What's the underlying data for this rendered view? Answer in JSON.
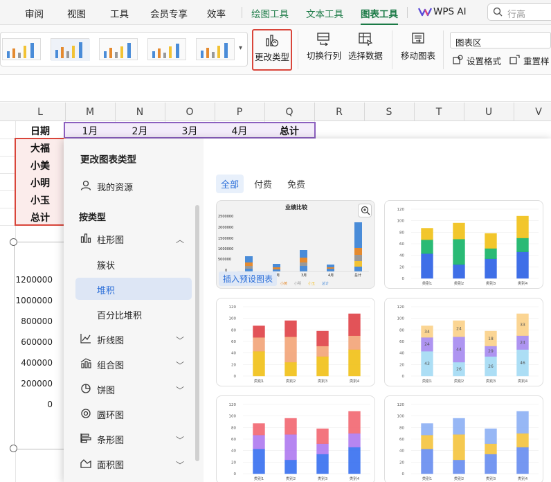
{
  "tabs": [
    {
      "label": "审阅"
    },
    {
      "label": "视图"
    },
    {
      "label": "工具"
    },
    {
      "label": "会员专享"
    },
    {
      "label": "效率"
    },
    {
      "label": "绘图工具"
    },
    {
      "label": "文本工具"
    },
    {
      "label": "图表工具"
    },
    {
      "label": "WPS AI"
    }
  ],
  "search": {
    "placeholder": "行高"
  },
  "ribbon": {
    "change_type": "更改类型",
    "switch_rowcol": "切换行列",
    "select_data": "选择数据",
    "move_chart": "移动图表",
    "chart_area": "图表区",
    "set_format": "设置格式",
    "reset_style": "重置样"
  },
  "sheet": {
    "columns": [
      "L",
      "M",
      "N",
      "O",
      "P",
      "Q",
      "R",
      "S",
      "T",
      "U",
      "V"
    ],
    "header_label": "日期",
    "months": [
      "1月",
      "2月",
      "3月",
      "4月",
      "总计"
    ],
    "rows": [
      "大福",
      "小美",
      "小明",
      "小玉",
      "总计"
    ],
    "y_ticks": [
      "1200000",
      "1000000",
      "800000",
      "600000",
      "400000",
      "200000",
      "0"
    ]
  },
  "dialog": {
    "title": "更改图表类型",
    "my_resources": "我的资源",
    "by_type": "按类型",
    "types": [
      {
        "label": "柱形图"
      },
      {
        "label": "折线图"
      },
      {
        "label": "组合图"
      },
      {
        "label": "饼图"
      },
      {
        "label": "圆环图"
      },
      {
        "label": "条形图"
      },
      {
        "label": "面积图"
      }
    ],
    "subtypes": [
      "簇状",
      "堆积",
      "百分比堆积"
    ],
    "filters": [
      "全部",
      "付费",
      "免费"
    ],
    "preview_title": "业绩比较",
    "insert_preset": "插入预设图表",
    "preview_y": [
      "2500000",
      "2000000",
      "1500000",
      "1000000",
      "500000",
      "0"
    ],
    "preview_x": [
      "1月",
      "2月",
      "3月",
      "4月",
      "总计"
    ],
    "preview_legend": [
      "小黄",
      "小明",
      "小玉",
      "总计"
    ],
    "card_y": [
      "120",
      "100",
      "80",
      "60",
      "40",
      "20",
      "0"
    ],
    "card_x": [
      "类别1",
      "类别2",
      "类别3",
      "类别4"
    ],
    "card3_labels": [
      [
        "43",
        "24",
        "34"
      ],
      [
        "26",
        "44",
        "24"
      ],
      [
        "26",
        "29",
        "18"
      ],
      [
        "46",
        "24",
        "33"
      ]
    ]
  },
  "chart_data": {
    "type": "bar",
    "categories": [
      "类别1",
      "类别2",
      "类别3",
      "类别4"
    ],
    "series": [
      {
        "values": [
          43,
          24,
          34,
          46
        ]
      },
      {
        "values": [
          24,
          44,
          18,
          24
        ]
      },
      {
        "values": [
          20,
          28,
          26,
          38
        ]
      }
    ],
    "ylim": [
      0,
      120
    ]
  },
  "colors": {
    "accent_green": "#1b7a46",
    "accent_blue": "#2c6fd9",
    "highlight_red": "#d9453a",
    "selection_purple": "#8b5fbf"
  }
}
